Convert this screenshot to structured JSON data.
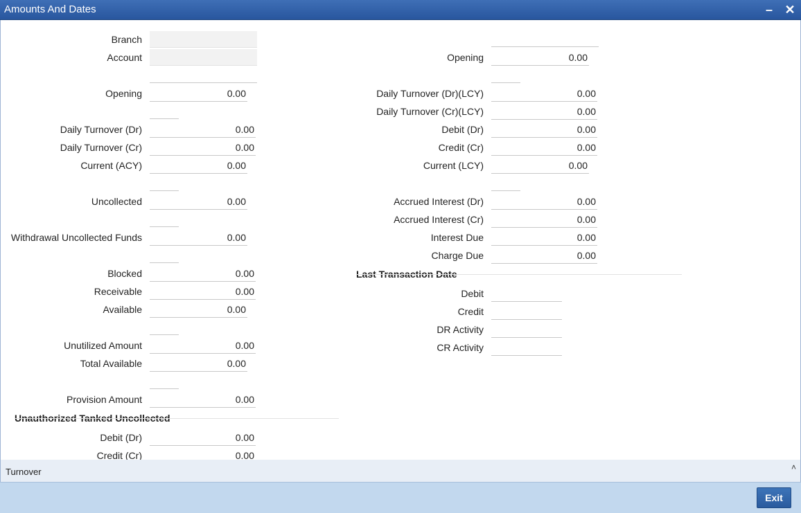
{
  "window": {
    "title": "Amounts And Dates"
  },
  "left": {
    "branch": {
      "label": "Branch",
      "value": ""
    },
    "account": {
      "label": "Account",
      "value": ""
    },
    "opening": {
      "label": "Opening",
      "value": "0.00"
    },
    "daily_turnover_dr": {
      "label": "Daily Turnover (Dr)",
      "value": "0.00"
    },
    "daily_turnover_cr": {
      "label": "Daily Turnover (Cr)",
      "value": "0.00"
    },
    "current_acy": {
      "label": "Current (ACY)",
      "value": "0.00"
    },
    "uncollected": {
      "label": "Uncollected",
      "value": "0.00"
    },
    "withdrawal_uncollected": {
      "label": "Withdrawal Uncollected Funds",
      "value": "0.00"
    },
    "blocked": {
      "label": "Blocked",
      "value": "0.00"
    },
    "receivable": {
      "label": "Receivable",
      "value": "0.00"
    },
    "available": {
      "label": "Available",
      "value": "0.00"
    },
    "unutilized": {
      "label": "Unutilized Amount",
      "value": "0.00"
    },
    "total_available": {
      "label": "Total Available",
      "value": "0.00"
    },
    "provision": {
      "label": "Provision Amount",
      "value": "0.00"
    },
    "unauth_section": "Unauthorized Tanked Uncollected",
    "unauth_debit": {
      "label": "Debit (Dr)",
      "value": "0.00"
    },
    "unauth_credit": {
      "label": "Credit (Cr)",
      "value": "0.00"
    }
  },
  "right": {
    "opening": {
      "label": "Opening",
      "value": "0.00"
    },
    "daily_turnover_dr_lcy": {
      "label": "Daily Turnover (Dr)(LCY)",
      "value": "0.00"
    },
    "daily_turnover_cr_lcy": {
      "label": "Daily Turnover (Cr)(LCY)",
      "value": "0.00"
    },
    "debit_dr": {
      "label": "Debit (Dr)",
      "value": "0.00"
    },
    "credit_cr": {
      "label": "Credit (Cr)",
      "value": "0.00"
    },
    "current_lcy": {
      "label": "Current (LCY)",
      "value": "0.00"
    },
    "accrued_dr": {
      "label": "Accrued Interest (Dr)",
      "value": "0.00"
    },
    "accrued_cr": {
      "label": "Accrued Interest (Cr)",
      "value": "0.00"
    },
    "interest_due": {
      "label": "Interest Due",
      "value": "0.00"
    },
    "charge_due": {
      "label": "Charge Due",
      "value": "0.00"
    },
    "ltd_section": "Last Transaction Date",
    "ltd_debit": {
      "label": "Debit",
      "value": ""
    },
    "ltd_credit": {
      "label": "Credit",
      "value": ""
    },
    "ltd_dr_activity": {
      "label": "DR Activity",
      "value": ""
    },
    "ltd_cr_activity": {
      "label": "CR Activity",
      "value": ""
    }
  },
  "footer": {
    "tab_label": "Turnover",
    "exit_label": "Exit"
  },
  "icons": {
    "minimize": "minimize-icon",
    "close": "close-icon",
    "collapse": "chevron-up-icon"
  }
}
